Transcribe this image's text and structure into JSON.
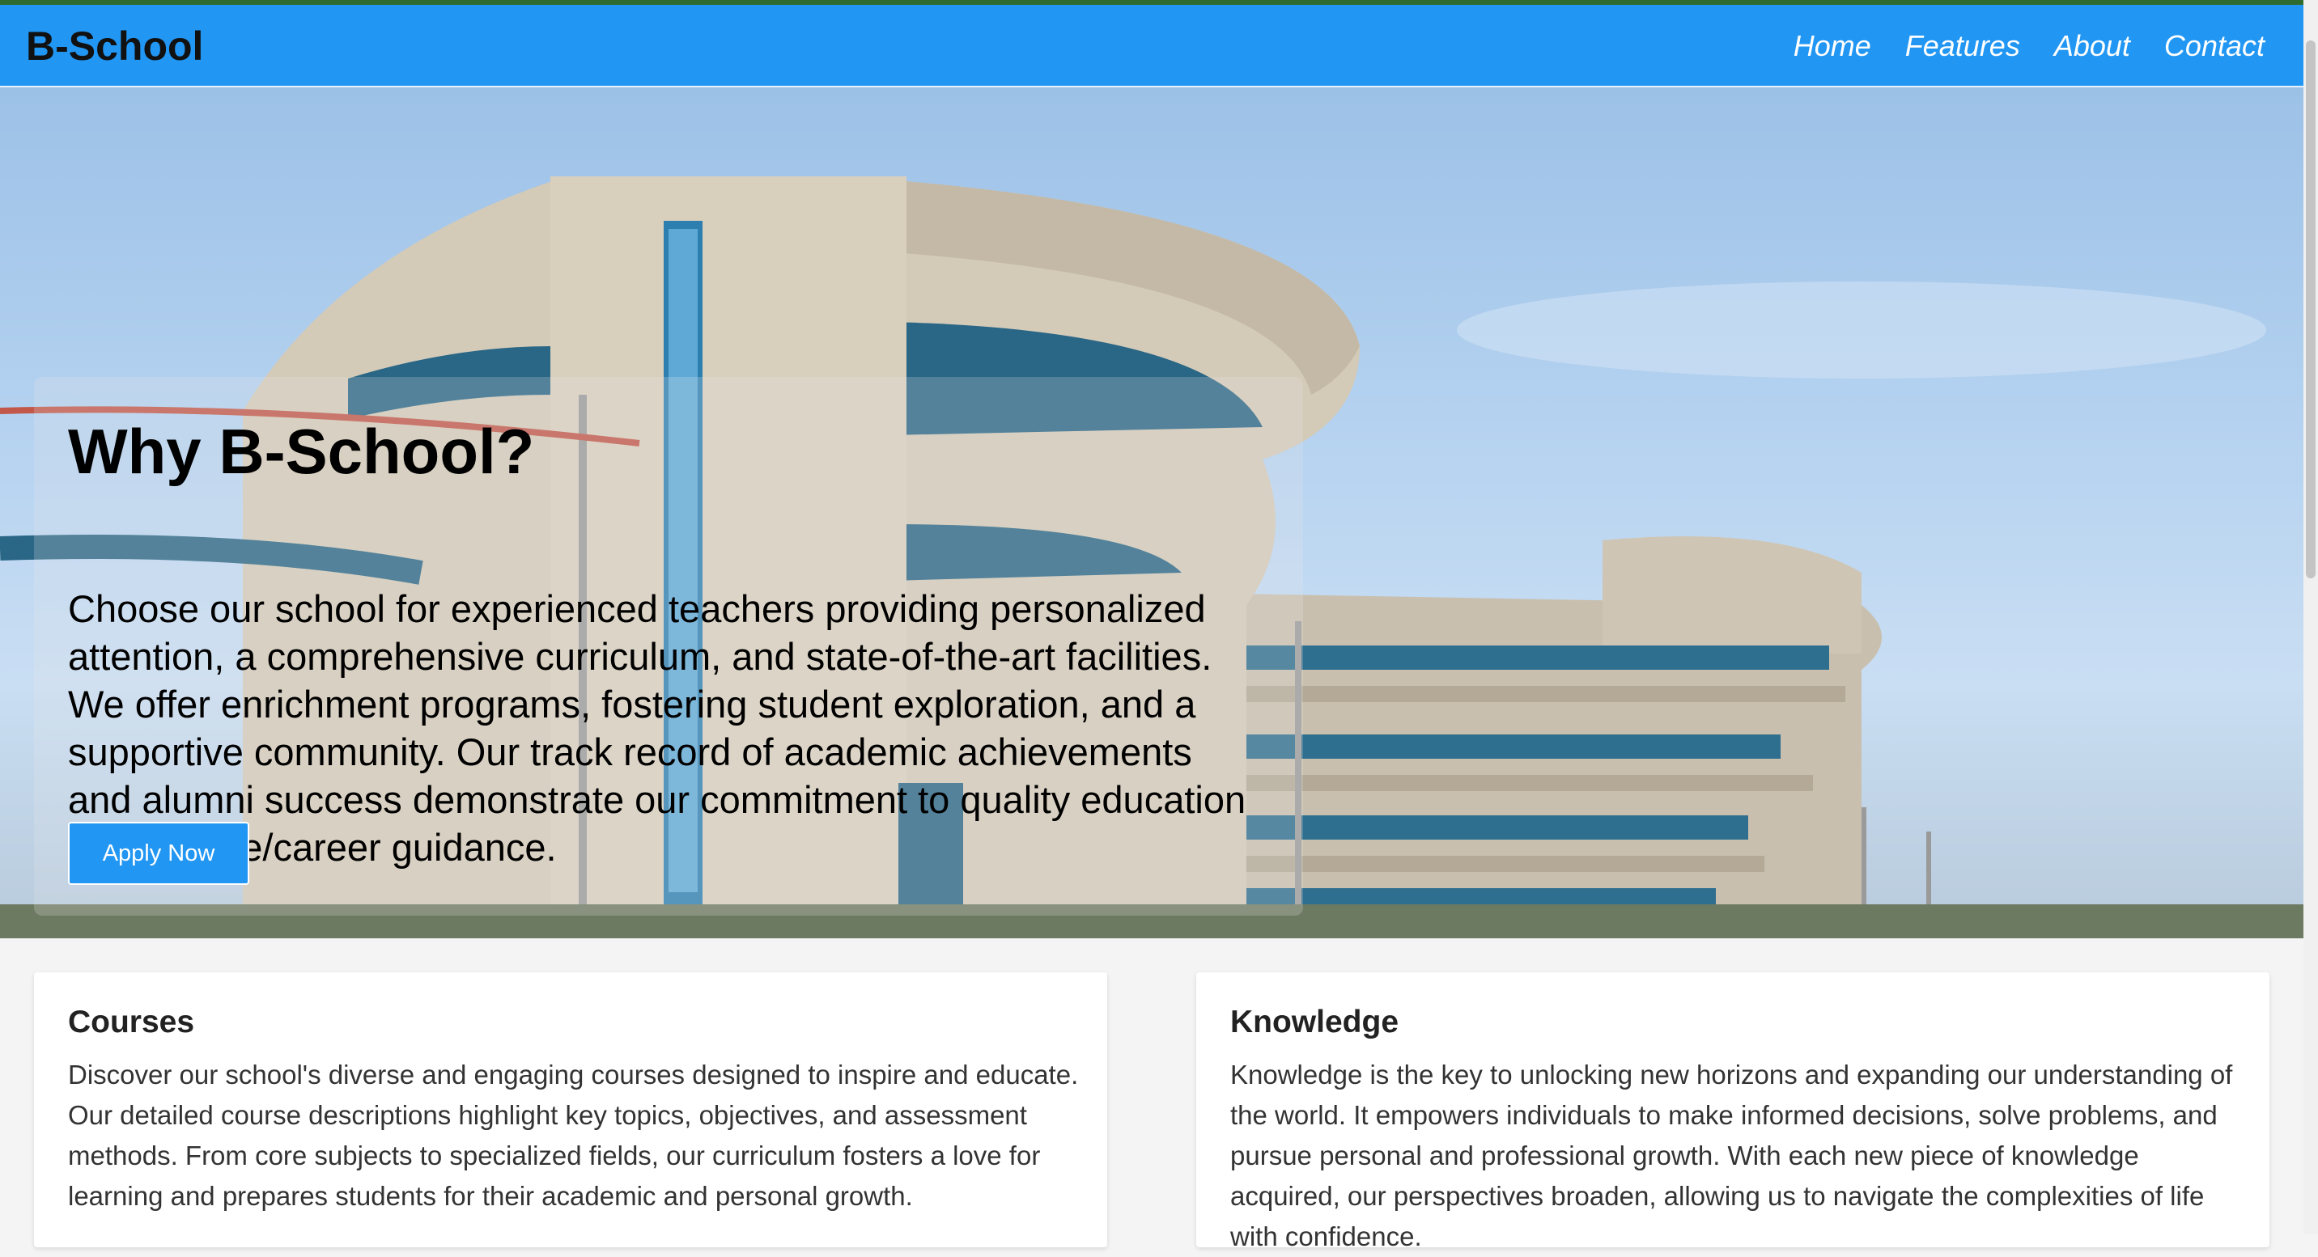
{
  "header": {
    "brand": "B-School",
    "nav": [
      "Home",
      "Features",
      "About",
      "Contact"
    ]
  },
  "hero": {
    "title": "Why B-School?",
    "text": "Choose our school for experienced teachers providing personalized attention, a comprehensive curriculum, and state-of-the-art facilities. We offer enrichment programs, fostering student exploration, and a supportive community. Our track record of academic achievements and alumni success demonstrate our commitment to quality education and college/career guidance.",
    "button_label": "Apply Now"
  },
  "cards": [
    {
      "title": "Courses",
      "text": "Discover our school's diverse and engaging courses designed to inspire and educate. Our detailed course descriptions highlight key topics, objectives, and assessment methods. From core subjects to specialized fields, our curriculum fosters a love for learning and prepares students for their academic and personal growth."
    },
    {
      "title": "Knowledge",
      "text": "Knowledge is the key to unlocking new horizons and expanding our understanding of the world. It empowers individuals to make informed decisions, solve problems, and pursue personal and professional growth. With each new piece of knowledge acquired, our perspectives broaden, allowing us to navigate the complexities of life with confidence."
    }
  ],
  "colors": {
    "accent": "#2196f3",
    "topline": "#2f6b2f"
  }
}
